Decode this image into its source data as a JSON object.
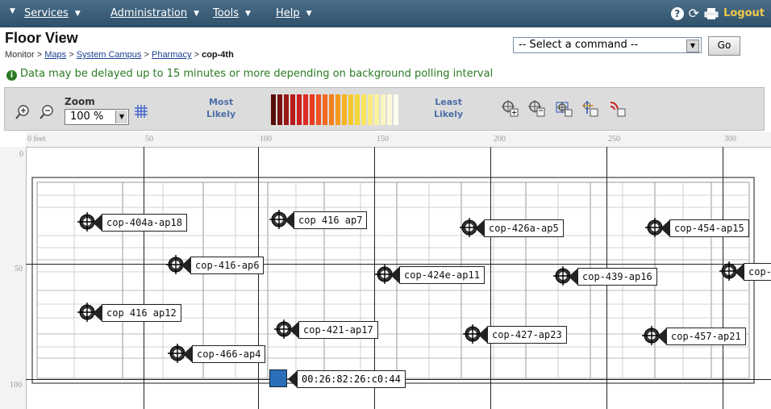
{
  "nav": {
    "menus": [
      {
        "label": "Services",
        "icon": "chevron-down-icon"
      },
      {
        "label": "Administration",
        "icon": "chevron-down-icon"
      },
      {
        "label": "Tools",
        "icon": "chevron-down-icon"
      },
      {
        "label": "Help",
        "icon": "chevron-down-icon"
      }
    ],
    "logout": "Logout",
    "icons": [
      "help-icon",
      "refresh-icon",
      "print-icon"
    ]
  },
  "header": {
    "title": "Floor View",
    "breadcrumb": {
      "root": "Monitor",
      "links": [
        "Maps",
        "System Campus",
        "Pharmacy"
      ],
      "current": "cop-4th",
      "separator": ">"
    },
    "command": {
      "selected": "-- Select a command --",
      "go": "Go"
    }
  },
  "notice": "Data may be delayed up to 15 minutes or more depending on background polling interval",
  "toolbar": {
    "zoom_label": "Zoom",
    "zoom_value": "100 %",
    "most_label": "Most\nLikely",
    "least_label": "Least\nLikely",
    "heat_colors": [
      "#5a0d0d",
      "#7a1212",
      "#9a1616",
      "#b81a1a",
      "#cc2020",
      "#dd2a22",
      "#e83a22",
      "#ef5020",
      "#f2681e",
      "#f4801c",
      "#f59a1c",
      "#f6b21e",
      "#f7c82a",
      "#f8d83a",
      "#f9e45a",
      "#faec7c",
      "#fbf2a0",
      "#fcf6c0",
      "#fdf9d8",
      "#fefcee"
    ],
    "icons": [
      "zoom-in-icon",
      "zoom-out-icon",
      "grid-icon",
      "locate-icon",
      "locate-delete-icon",
      "locate-area-icon",
      "locate-move-icon",
      "signal-locate-icon"
    ]
  },
  "map": {
    "ruler_x": [
      "0 feet",
      "50",
      "100",
      "150",
      "200",
      "250",
      "300"
    ],
    "ruler_y": [
      "0",
      "50",
      "100"
    ],
    "access_points": [
      "cop-404a-ap18",
      "cop 416 ap7",
      "cop-426a-ap5",
      "cop-454-ap15",
      "cop-416-ap6",
      "cop-424e-ap11",
      "cop-439-ap16",
      "cop-",
      "cop 416 ap12",
      "cop-421-ap17",
      "cop-427-ap23",
      "cop-457-ap21",
      "cop-466-ap4"
    ],
    "client": "00:26:82:26:c0:44"
  }
}
